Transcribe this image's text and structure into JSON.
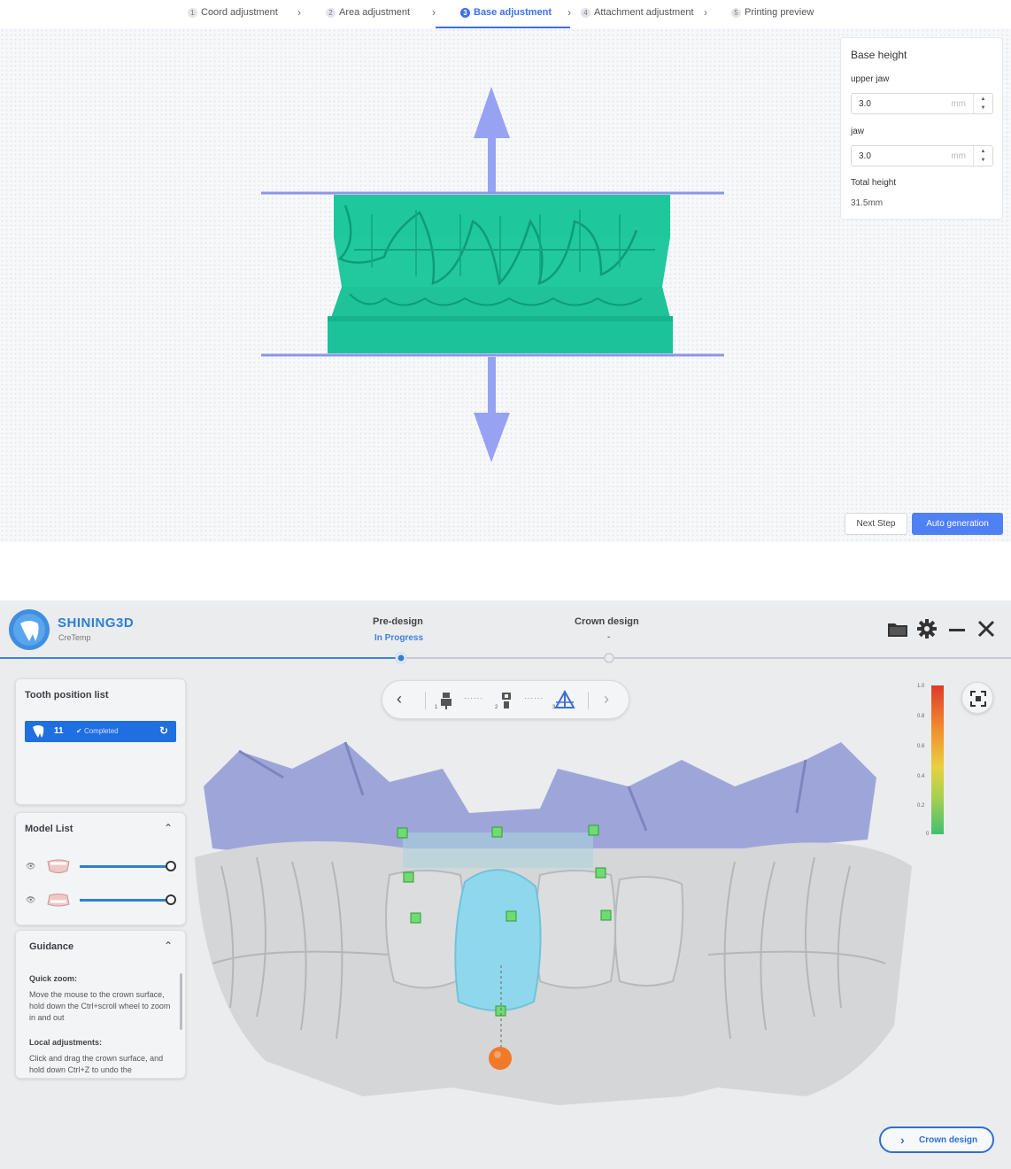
{
  "base_adjustment_screen": {
    "steps": [
      {
        "num": "1",
        "label": "Coord adjustment"
      },
      {
        "num": "2",
        "label": "Area adjustment"
      },
      {
        "num": "3",
        "label": "Base adjustment"
      },
      {
        "num": "4",
        "label": "Attachment adjustment"
      },
      {
        "num": "5",
        "label": "Printing preview"
      }
    ],
    "active_step": "Base adjustment",
    "accent_color": "#3d6ff5",
    "model_color": "#1fc79c",
    "base_height_panel": {
      "title": "Base height",
      "upper_jaw_label": "upper jaw",
      "upper_jaw_value": "3.0",
      "upper_jaw_unit": "mm",
      "jaw_label": "jaw",
      "jaw_value": "3.0",
      "jaw_unit": "mm",
      "total_height_label": "Total height",
      "total_height_value": "31.5mm"
    },
    "buttons": {
      "next_step": "Next Step",
      "auto_generation": "Auto generation"
    }
  },
  "crown_design_screen": {
    "brand": {
      "name": "SHINING3D",
      "product": "CreTemp"
    },
    "stages": [
      {
        "label": "Pre-design",
        "status": "In Progress"
      },
      {
        "label": "Crown design",
        "status": "-"
      }
    ],
    "window_icons": [
      "folder-icon",
      "gear-icon",
      "minimize-icon",
      "close-icon"
    ],
    "tooth_position_list": {
      "title": "Tooth position list",
      "items": [
        {
          "number": "11",
          "status": "Completed"
        }
      ]
    },
    "model_list": {
      "title": "Model List",
      "items": [
        {
          "name": "upper-jaw",
          "opacity": 1.0
        },
        {
          "name": "lower-jaw",
          "opacity": 1.0
        }
      ]
    },
    "guidance": {
      "title": "Guidance",
      "sections": [
        {
          "heading": "Quick zoom:",
          "text": "Move the mouse to the crown surface, hold down the Ctrl+scroll wheel to zoom in and out"
        },
        {
          "heading": "Local adjustments:",
          "text": "Click and drag the crown surface, and hold down Ctrl+Z to undo the"
        }
      ]
    },
    "toolbar": {
      "step_labels": [
        "1",
        "2",
        "3"
      ]
    },
    "color_scale": {
      "labels": [
        "1.0",
        "0.8",
        "0.6",
        "0.4",
        "0.2",
        "0"
      ]
    },
    "next_button": "Crown design",
    "accent_color": "#3f83d8"
  }
}
